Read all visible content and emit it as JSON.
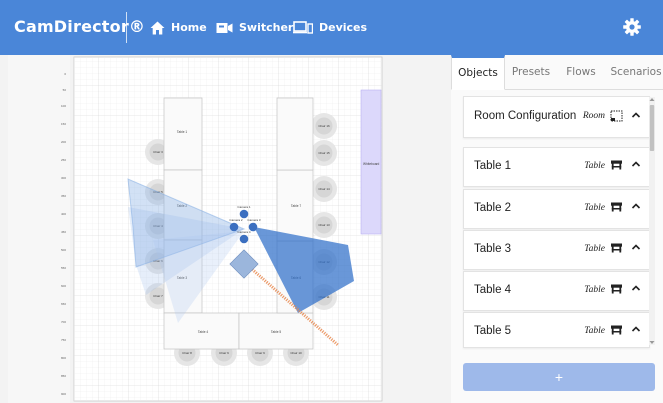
{
  "app": {
    "title": "CamDirector®"
  },
  "nav": {
    "home": "Home",
    "switcher": "Switcher",
    "devices": "Devices"
  },
  "room": {
    "tables": [
      {
        "label": "Table 1"
      },
      {
        "label": "Table 2"
      },
      {
        "label": "Table 3"
      },
      {
        "label": "Table 4"
      },
      {
        "label": "Table 5"
      },
      {
        "label": "Table 6"
      },
      {
        "label": "Table 7"
      }
    ],
    "chairs": [
      "Chair 1",
      "Chair 2",
      "Chair 3",
      "Chair 4",
      "Chair 5",
      "Chair 6",
      "Chair 7",
      "Chair 8",
      "Chair 9",
      "Chair 10",
      "Chair 11",
      "Chair 12",
      "Chair 13",
      "Chair 14",
      "Chair 15",
      "Chair 16"
    ],
    "cameras": [
      "Camera 1",
      "Camera 2",
      "Camera 3",
      "Camera 4"
    ],
    "whiteboard": "Whiteboard"
  },
  "panel": {
    "tabs": [
      "Objects",
      "Presets",
      "Flows",
      "Scenarios"
    ],
    "active_tab": "Objects",
    "items": [
      {
        "name": "Room Configuration",
        "type": "Room",
        "icon": "room-icon"
      },
      {
        "name": "Table 1",
        "type": "Table",
        "icon": "table-icon"
      },
      {
        "name": "Table 2",
        "type": "Table",
        "icon": "table-icon"
      },
      {
        "name": "Table 3",
        "type": "Table",
        "icon": "table-icon"
      },
      {
        "name": "Table 4",
        "type": "Table",
        "icon": "table-icon"
      },
      {
        "name": "Table 5",
        "type": "Table",
        "icon": "table-icon"
      }
    ],
    "add_label": "+"
  },
  "colors": {
    "accent": "#4a86d8",
    "camera": "#3b6fc0",
    "fov": "#5b8fd6",
    "whiteboard": "#dcd8fb"
  }
}
